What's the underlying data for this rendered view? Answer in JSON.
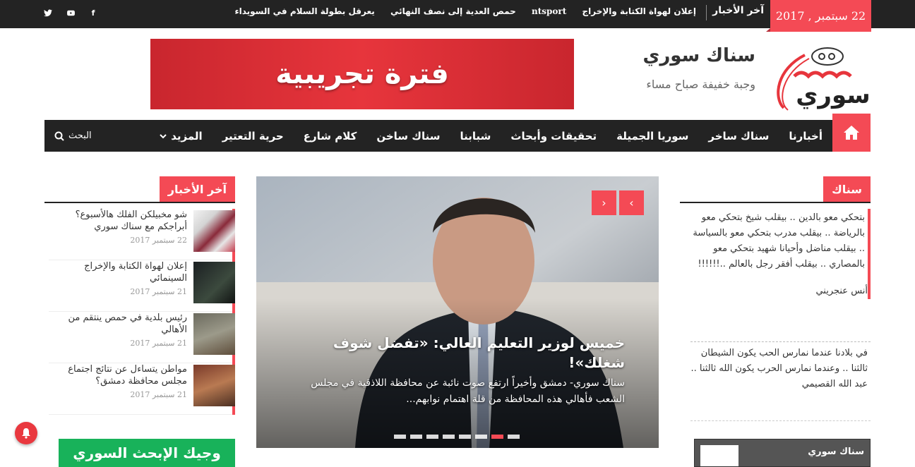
{
  "topbar": {
    "date": "22 سبتمبر , 2017",
    "latest_label": "آخر الأخبار",
    "ticker": [
      "إعلان لهواة الكتابة والإخراج",
      "ntsport",
      "حمص العدية إلى نصف النهائي",
      "يعرقل بطولة السلام في السويداء",
      "%"
    ],
    "social": {
      "facebook": "f",
      "youtube": "▶",
      "twitter": "t"
    }
  },
  "header": {
    "site_title": "سناك سوري",
    "tagline": "وجبة خفيفة صباح مساء",
    "logo_text": "سوري",
    "banner_text": "فترة تجريبية"
  },
  "nav": {
    "items": [
      "أخبارنا",
      "سناك ساخر",
      "سوريا الجميلة",
      "تحقيقات وأبحاث",
      "شبابنا",
      "سناك ساخن",
      "كلام شارع",
      "حرية التعتير"
    ],
    "more_label": "المزيد",
    "search_label": "البحث"
  },
  "left": {
    "header": "آخر الأخبار",
    "items": [
      {
        "title": "شو مخبيلكن الفلك هالأسبوع؟ أبراجكم مع سناك سوري",
        "date": "22 سبتمبر 2017"
      },
      {
        "title": "إعلان لهواة الكتابة والإخراج السينمائي",
        "date": "21 سبتمبر 2017"
      },
      {
        "title": "رئيس بلدية في حمص ينتقم من الأهالي",
        "date": "21 سبتمبر 2017"
      },
      {
        "title": "مواطن يتساءل عن نتائج اجتماع مجلس محافظة دمشق؟",
        "date": "21 سبتمبر 2017"
      }
    ],
    "green_box": "وجيك الإبحث السوري"
  },
  "slider": {
    "title": "خميس لوزير التعليم العالي: «تفضل شوف شغلك»!",
    "excerpt": "سناك سوري- دمشق وأخيراً ارتفع صوت نائبة عن محافظة اللاذقية في مجلس الشعب فأهالي هذه المحافظة من قلة اهتمام نوابهم...",
    "prev_arrow": "‹",
    "next_arrow": "›",
    "dot_count": 8,
    "active_dot": 6
  },
  "right": {
    "header": "سناك",
    "quote1": "بتحكي معو بالدين .. بيقلب شيخ بتحكي معو بالرياضة .. بيقلب مدرب بتحكي معو بالسياسة .. بيقلب مناضل وأحيانا شهيد بتحكي معو بالمصاري .. بيقلب أفقر رجل بالعالم ..!!!!!!",
    "author1": "أنس عنجريني",
    "quote2": "في بلادنا عندما نمارس الحب يكون الشيطان ثالثنا .. وعندما نمارس الحرب يكون الله ثالثنا ..",
    "author2": "عبد الله القصيمي",
    "video_title": "سناك سوري"
  },
  "colors": {
    "accent": "#f44a55",
    "dark": "#232323",
    "green": "#18b25a"
  }
}
